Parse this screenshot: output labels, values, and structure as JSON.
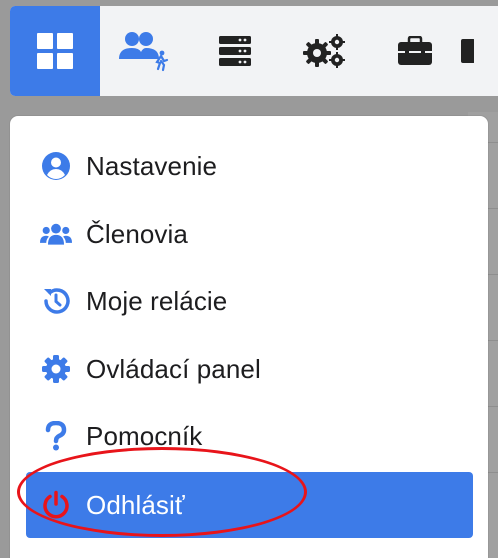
{
  "colors": {
    "accent": "#3d7be8",
    "icon_blue": "#3d7be8",
    "annotation_red": "#e8141a",
    "text": "#1d1d1f"
  },
  "navbar": {
    "items": [
      {
        "icon": "grid-icon",
        "active": true
      },
      {
        "icon": "users-running-icon",
        "active": false
      },
      {
        "icon": "server-icon",
        "active": false
      },
      {
        "icon": "gears-icon",
        "active": false
      },
      {
        "icon": "toolbox-icon",
        "active": false
      },
      {
        "icon": "partial-icon",
        "active": false
      }
    ]
  },
  "menu": {
    "items": [
      {
        "label": "Nastavenie",
        "icon": "user-circle-icon"
      },
      {
        "label": "Členovia",
        "icon": "users-icon"
      },
      {
        "label": "Moje relácie",
        "icon": "history-icon"
      },
      {
        "label": "Ovládací panel",
        "icon": "gear-icon"
      },
      {
        "label": "Pomocník",
        "icon": "question-icon"
      },
      {
        "label": "Odhlásiť",
        "icon": "power-icon",
        "active": true
      }
    ]
  }
}
